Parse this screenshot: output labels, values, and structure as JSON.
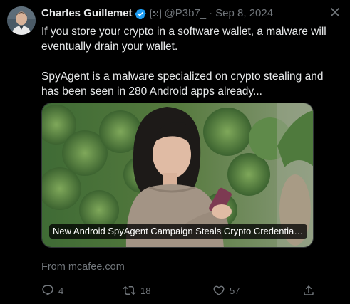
{
  "author": {
    "name": "Charles Guillemet",
    "handle": "@P3b7_",
    "separator": "·",
    "date": "Sep 8, 2024",
    "verified_icon": "verified-badge-icon",
    "affiliation_icon": "affiliation-badge-icon"
  },
  "tweet": {
    "paragraph_1": "If you store your crypto in a software wallet, a malware will eventually drain your wallet.",
    "paragraph_2": "SpyAgent is a malware specialized on crypto stealing and has been seen in 280 Android apps already..."
  },
  "card": {
    "title": "New Android SpyAgent Campaign Steals Crypto Credentials via Image Recognition",
    "source": "From mcafee.com"
  },
  "actions": {
    "replies": "4",
    "reposts": "18",
    "likes": "57"
  },
  "colors": {
    "background": "#000000",
    "text": "#e7e9ea",
    "muted": "#71767b",
    "verified": "#1d9bf0"
  }
}
